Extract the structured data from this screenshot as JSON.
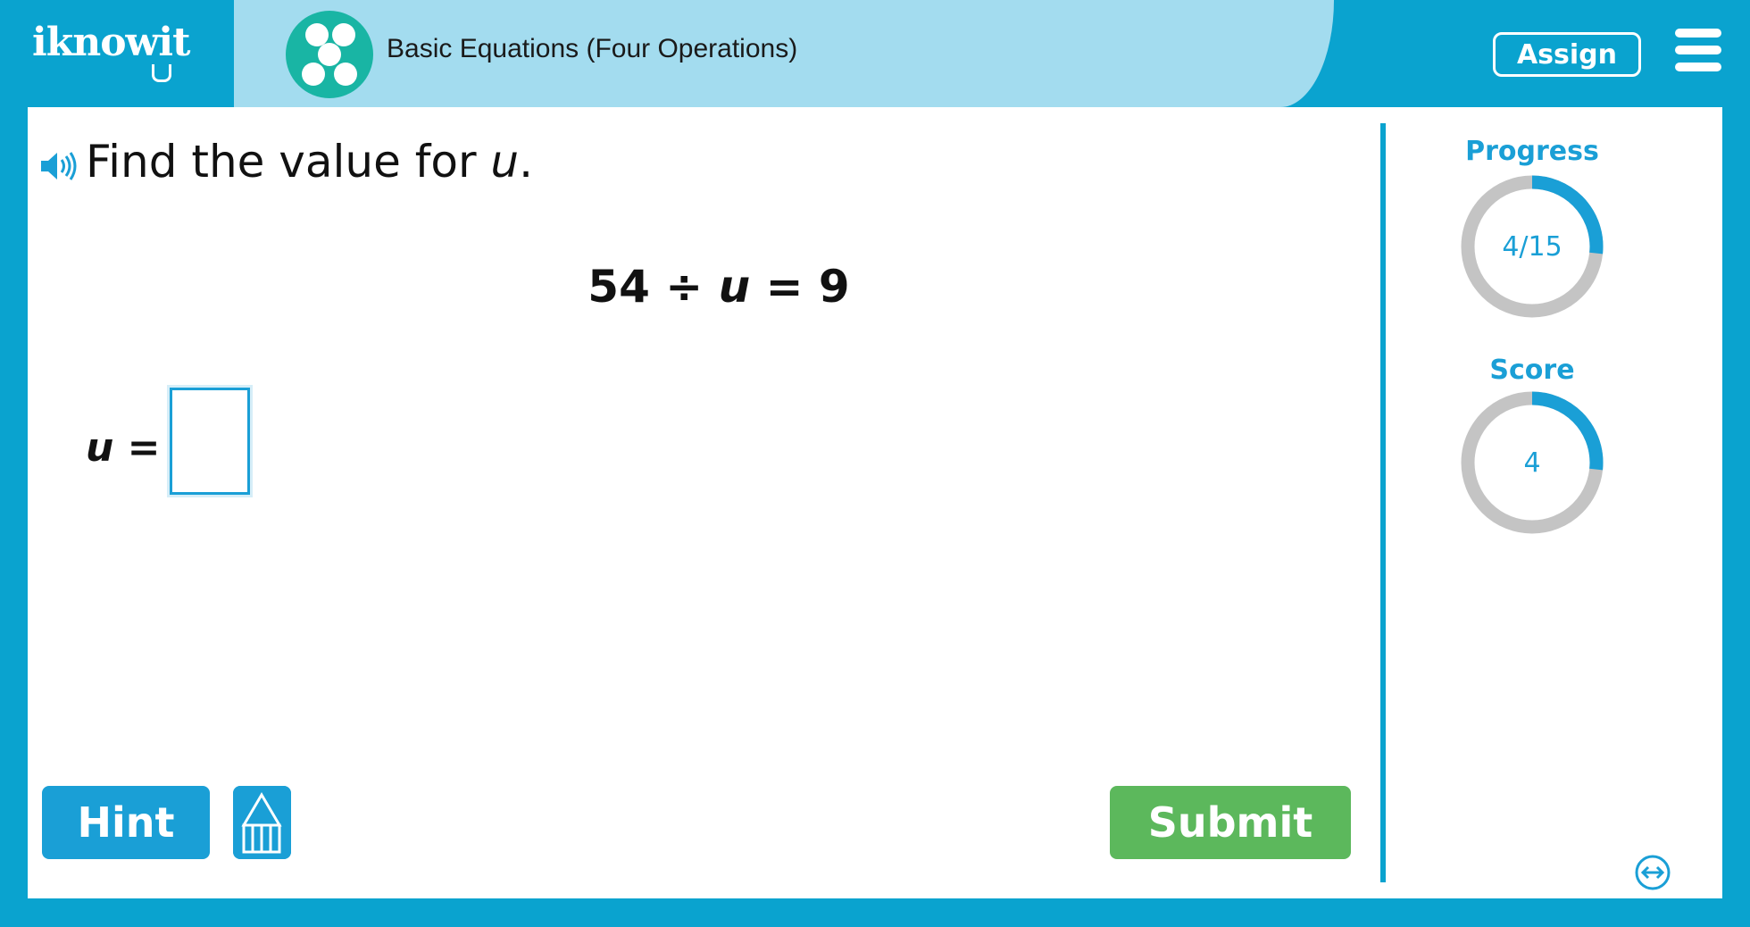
{
  "header": {
    "logo_text": "iknowit",
    "lesson_title": "Basic Equations (Four Operations)",
    "assign_label": "Assign",
    "icons": [
      "lightbulb-icon",
      "dots-icon",
      "menu-icon"
    ]
  },
  "question": {
    "prompt_text": "Find the value for ",
    "prompt_var": "u",
    "prompt_end": ".",
    "equation_left": "54 ÷ ",
    "equation_var": "u",
    "equation_right": " = 9",
    "answer_var": "u",
    "answer_eq": " =",
    "answer_value": ""
  },
  "actions": {
    "hint_label": "Hint",
    "submit_label": "Submit"
  },
  "sidebar": {
    "progress_label": "Progress",
    "progress_text": "4/15",
    "progress_fraction": 0.2667,
    "score_label": "Score",
    "score_text": "4",
    "score_fraction": 0.2667
  },
  "colors": {
    "brand_blue": "#0aa3cf",
    "accent_blue": "#1a9fd6",
    "banner": "#a3dcef",
    "teal": "#19b5a4",
    "submit_green": "#5cb85c",
    "ring_gray": "#c4c4c4"
  }
}
